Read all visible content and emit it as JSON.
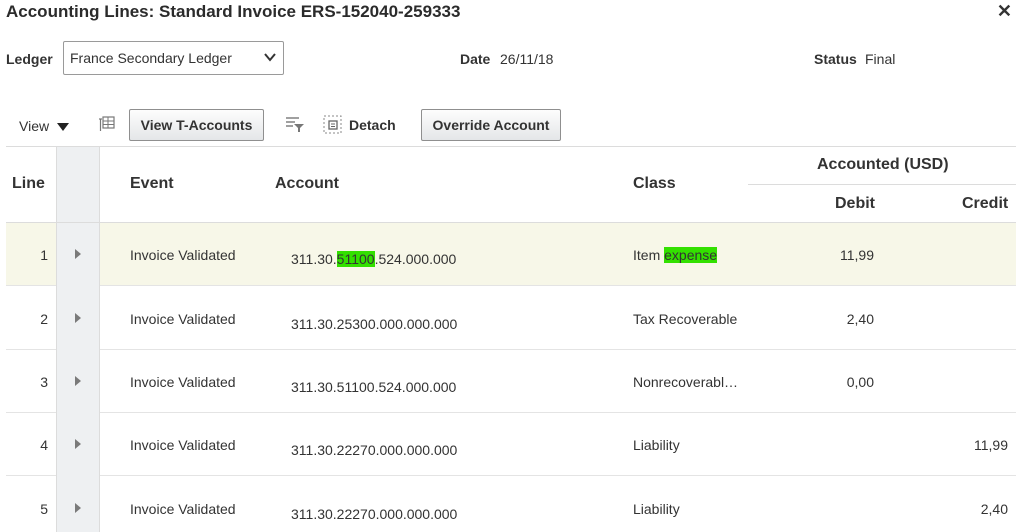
{
  "dialog": {
    "title": "Accounting Lines: Standard Invoice ERS-152040-259333",
    "close_glyph": "✕"
  },
  "header": {
    "ledger_label": "Ledger",
    "ledger_value": "France Secondary Ledger",
    "date_label": "Date",
    "date_value": "26/11/18",
    "status_label": "Status",
    "status_value": "Final"
  },
  "toolbar": {
    "view_label": "View",
    "view_t_accounts": "View T-Accounts",
    "detach": "Detach",
    "override_account": "Override Account"
  },
  "table": {
    "columns": {
      "line": "Line",
      "event": "Event",
      "account": "Account",
      "class": "Class",
      "accounted": "Accounted (USD)",
      "debit": "Debit",
      "credit": "Credit"
    },
    "rows": [
      {
        "line": "1",
        "event": "Invoice Validated",
        "account_pre": "311.30.",
        "account_hl": "51100",
        "account_post": ".524.000.000",
        "class_pre": "Item ",
        "class_hl": "expense",
        "debit": "11,99",
        "credit": ""
      },
      {
        "line": "2",
        "event": "Invoice Validated",
        "account_pre": "311.30.25300.000.000.000",
        "account_hl": "",
        "account_post": "",
        "class_pre": "Tax Recoverable",
        "class_hl": "",
        "debit": "2,40",
        "credit": ""
      },
      {
        "line": "3",
        "event": "Invoice Validated",
        "account_pre": "311.30.51100.524.000.000",
        "account_hl": "",
        "account_post": "",
        "class_pre": "Nonrecoverabl…",
        "class_hl": "",
        "debit": "0,00",
        "credit": ""
      },
      {
        "line": "4",
        "event": "Invoice Validated",
        "account_pre": "311.30.22270.000.000.000",
        "account_hl": "",
        "account_post": "",
        "class_pre": "Liability",
        "class_hl": "",
        "debit": "",
        "credit": "11,99"
      },
      {
        "line": "5",
        "event": "Invoice Validated",
        "account_pre": "311.30.22270.000.000.000",
        "account_hl": "",
        "account_post": "",
        "class_pre": "Liability",
        "class_hl": "",
        "debit": "",
        "credit": "2,40"
      }
    ],
    "selected_row": "1"
  },
  "colors": {
    "highlight": "#33e000",
    "selected_row_bg": "#f7f7e8",
    "column_band": "#eef0f2"
  },
  "icons": [
    "close-icon",
    "chevron-down-icon",
    "view-dropdown-icon",
    "freeze-columns-icon",
    "query-by-example-icon",
    "detach-icon",
    "disclosure-icon"
  ]
}
